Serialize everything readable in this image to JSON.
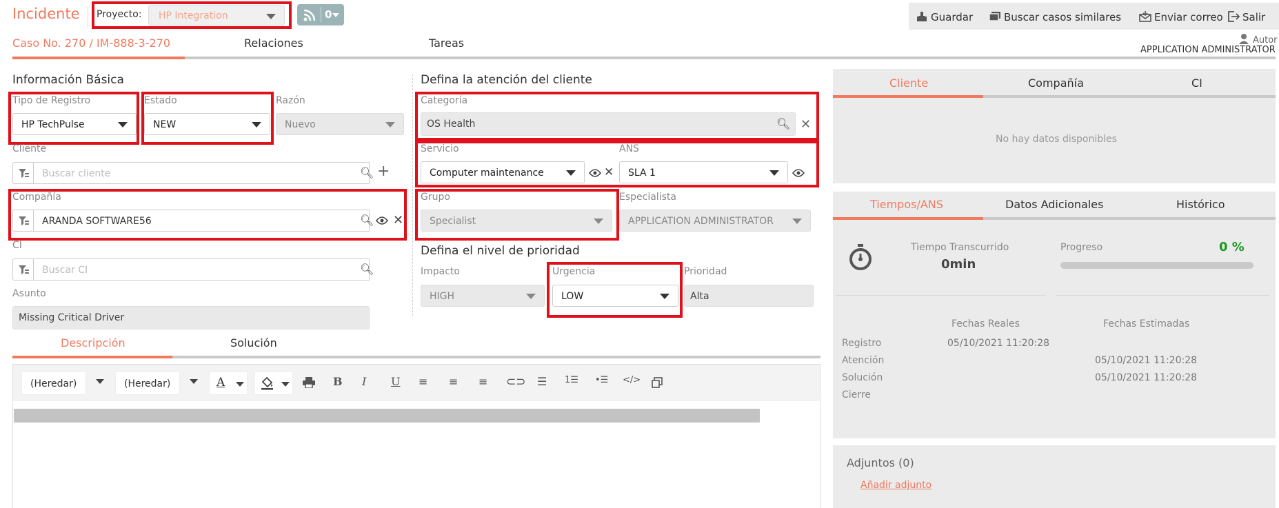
{
  "header": {
    "title": "Incidente",
    "project_label": "Proyecto:",
    "project_value": "HP Integration",
    "feed_count": "0"
  },
  "toolbar": {
    "save": "Guardar",
    "search_similar": "Buscar casos similares",
    "send_mail": "Enviar correo",
    "exit": "Salir"
  },
  "tabs": {
    "case": "Caso No. 270 / IM-888-3-270",
    "relations": "Relaciones",
    "tasks": "Tareas"
  },
  "author": {
    "label": "Autor",
    "name": "APPLICATION ADMINISTRATOR"
  },
  "basic": {
    "title": "Información Básica",
    "record_type_label": "Tipo de Registro",
    "record_type_value": "HP TechPulse",
    "state_label": "Estado",
    "state_value": "NEW",
    "reason_label": "Razón",
    "reason_value": "Nuevo",
    "client_label": "Cliente",
    "client_placeholder": "Buscar cliente",
    "company_label": "Compañía",
    "company_value": "ARANDA SOFTWARE56",
    "ci_label": "CI",
    "ci_placeholder": "Buscar CI",
    "subject_label": "Asunto",
    "subject_value": "Missing Critical Driver"
  },
  "attention": {
    "title": "Defina la atención del cliente",
    "category_label": "Categoría",
    "category_value": "OS Health",
    "service_label": "Servicio",
    "service_value": "Computer maintenance",
    "ans_label": "ANS",
    "ans_value": "SLA 1",
    "group_label": "Grupo",
    "group_value": "Specialist",
    "specialist_label": "Especialista",
    "specialist_value": "APPLICATION ADMINISTRATOR"
  },
  "priority": {
    "title": "Defina el nivel de prioridad",
    "impact_label": "Impacto",
    "impact_value": "HIGH",
    "urgency_label": "Urgencia",
    "urgency_value": "LOW",
    "priority_label": "Prioridad",
    "priority_value": "Alta"
  },
  "description": {
    "tab_description": "Descripción",
    "tab_solution": "Solución",
    "font_family": "(Heredar)",
    "font_size": "(Heredar)"
  },
  "info_panel": {
    "tabs": [
      "Cliente",
      "Compañía",
      "CI"
    ],
    "empty": "No hay datos disponibles"
  },
  "sla_panel": {
    "tabs": [
      "Tiempos/ANS",
      "Datos Adicionales",
      "Histórico"
    ],
    "elapsed_label": "Tiempo Transcurrido",
    "elapsed_value": "0min",
    "progress_label": "Progreso",
    "progress_value": "0 %",
    "progress_fraction": 0,
    "real_dates_label": "Fechas Reales",
    "estimated_dates_label": "Fechas Estimadas",
    "rows": [
      {
        "label": "Registro",
        "real": "05/10/2021 11:20:28",
        "estimated": ""
      },
      {
        "label": "Atención",
        "real": "",
        "estimated": "05/10/2021 11:20:28"
      },
      {
        "label": "Solución",
        "real": "",
        "estimated": "05/10/2021 11:20:28"
      },
      {
        "label": "Cierre",
        "real": "",
        "estimated": ""
      }
    ]
  },
  "attachments": {
    "title": "Adjuntos (0)",
    "add_link": "Añadir adjunto"
  },
  "colors": {
    "accent": "#f07a5e",
    "highlight": "#e0111b",
    "success": "#1e9a1e"
  }
}
